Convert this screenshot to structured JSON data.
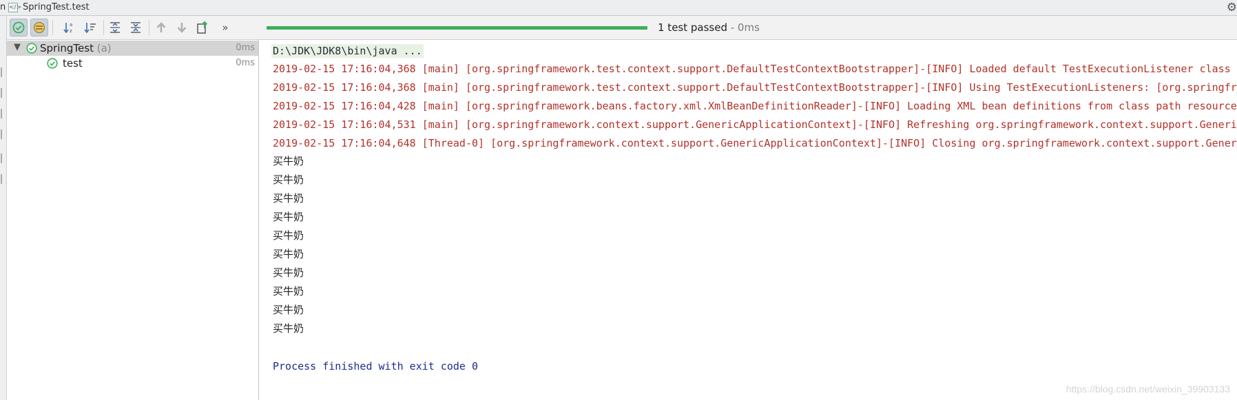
{
  "window": {
    "left_fragment": "n",
    "title": "SpringTest.test"
  },
  "toolbar": {
    "buttons": [
      {
        "name": "show-passed-button",
        "icon": "check-circle-icon",
        "active": true
      },
      {
        "name": "show-ignored-button",
        "icon": "ignored-icon",
        "active": true
      },
      {
        "name": "sort-alphabetically-button",
        "icon": "sort-az-icon"
      },
      {
        "name": "sort-by-duration-button",
        "icon": "sort-duration-icon"
      },
      {
        "name": "expand-all-button",
        "icon": "expand-all-icon"
      },
      {
        "name": "collapse-all-button",
        "icon": "collapse-all-icon"
      },
      {
        "name": "previous-failed-button",
        "icon": "arrow-up-icon"
      },
      {
        "name": "next-failed-button",
        "icon": "arrow-down-icon"
      },
      {
        "name": "export-results-button",
        "icon": "export-icon"
      },
      {
        "name": "more-button",
        "icon": "double-chevron-right-icon"
      }
    ],
    "progress_fraction": 1.0,
    "progress_color": "#3bb05b",
    "status": "1 test passed",
    "duration": " - 0ms"
  },
  "tree": {
    "root": {
      "label": "SpringTest",
      "hint": "(a)",
      "time": "0ms",
      "status_color": "#3bb05b"
    },
    "children": [
      {
        "label": "test",
        "time": "0ms"
      }
    ]
  },
  "console": {
    "command": "D:\\JDK\\JDK8\\bin\\java ...",
    "log_lines": [
      "2019-02-15 17:16:04,368 [main] [org.springframework.test.context.support.DefaultTestContextBootstrapper]-[INFO] Loaded default TestExecutionListener class n",
      "2019-02-15 17:16:04,368 [main] [org.springframework.test.context.support.DefaultTestContextBootstrapper]-[INFO] Using TestExecutionListeners: [org.springfra",
      "2019-02-15 17:16:04,428 [main] [org.springframework.beans.factory.xml.XmlBeanDefinitionReader]-[INFO] Loading XML bean definitions from class path resource",
      "2019-02-15 17:16:04,531 [main] [org.springframework.context.support.GenericApplicationContext]-[INFO] Refreshing org.springframework.context.support.Generic",
      "2019-02-15 17:16:04,648 [Thread-0] [org.springframework.context.support.GenericApplicationContext]-[INFO] Closing org.springframework.context.support.Generi"
    ],
    "output_lines": [
      "买牛奶",
      "买牛奶",
      "买牛奶",
      "买牛奶",
      "买牛奶",
      "买牛奶",
      "买牛奶",
      "买牛奶",
      "买牛奶",
      "买牛奶"
    ],
    "exit_message": "Process finished with exit code 0",
    "log_color": "#b3322a",
    "exit_color": "#1d2c8f"
  },
  "watermark": "https://blog.csdn.net/weixin_39903133"
}
